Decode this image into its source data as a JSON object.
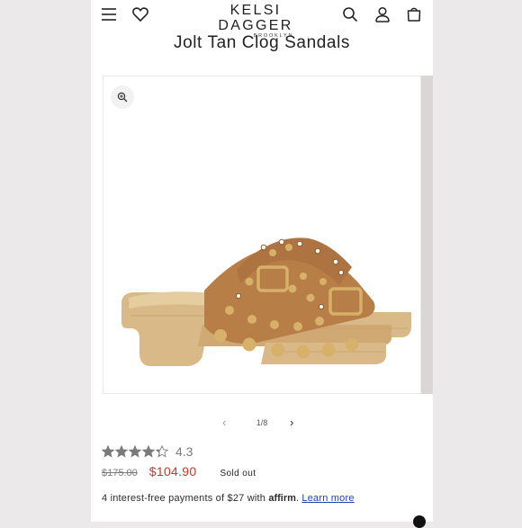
{
  "brand": {
    "name": "KELSI DAGGER",
    "subtitle": "BROOKLYN"
  },
  "header": {
    "icons": [
      "menu-icon",
      "heart-icon",
      "search-icon",
      "account-icon",
      "cart-icon"
    ]
  },
  "product": {
    "title": "Jolt Tan Clog Sandals",
    "rating_value": "4.3",
    "rating_stars": 4.3,
    "price_original": "$175.00",
    "price_sale": "$104.90",
    "status": "Sold out"
  },
  "gallery": {
    "counter": "1/8",
    "zoom_icon": "zoom-in-icon"
  },
  "financing": {
    "text": "4 interest-free payments of $27 with ",
    "brand": "affirm",
    "after": ". ",
    "link": "Learn more"
  },
  "colors": {
    "sale_price": "#c0392b",
    "link": "#1f3fb5",
    "sandal_leather": "#b77e48",
    "stud": "#d7b16a",
    "sole": "#d9b988"
  }
}
